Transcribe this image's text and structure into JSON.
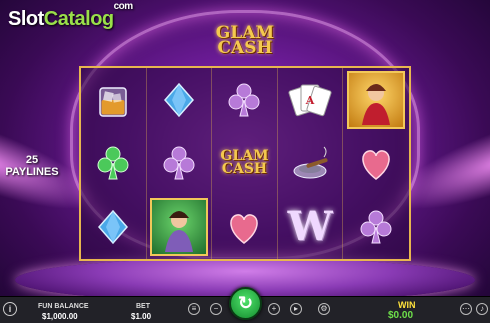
{
  "brand": {
    "part1": "Slot",
    "part2": "Catalog",
    "suffix": "com"
  },
  "game": {
    "title_line1": "GLAM",
    "title_line2": "CASH"
  },
  "paylines": {
    "count": "25",
    "label": "PAYLINES"
  },
  "reels": [
    [
      "whiskey-glass",
      "green-club",
      "blue-diamond"
    ],
    [
      "blue-diamond",
      "purple-club",
      "showgirl-green"
    ],
    [
      "purple-club",
      "glam-cash-logo",
      "pink-heart"
    ],
    [
      "playing-cards",
      "ashtray-cigar",
      "wild-w"
    ],
    [
      "showgirl-gold",
      "pink-heart",
      "purple-club"
    ]
  ],
  "reel_symbol_text": {
    "glam_line1": "GLAM",
    "glam_line2": "CASH",
    "wild": "W"
  },
  "balance": {
    "label": "FUN BALANCE",
    "value": "$1,000.00"
  },
  "bet": {
    "label": "BET",
    "value": "$1.00"
  },
  "win": {
    "label": "WIN",
    "value": "$0.00"
  },
  "controls": {
    "info": "i",
    "spin_icon": "spin-arrow-icon"
  },
  "colors": {
    "frame_gold": "#e7b64f",
    "win_label": "#ffe23c",
    "win_value": "#6ee04a",
    "spin_green": "#2fc24a"
  }
}
